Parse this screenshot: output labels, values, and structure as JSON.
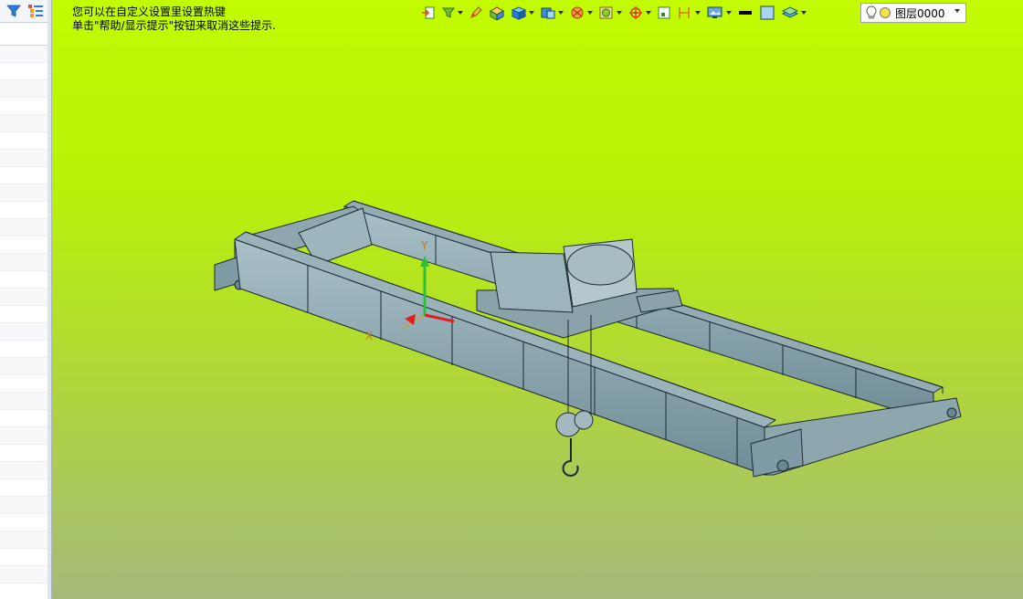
{
  "hint": {
    "line1": "您可以在自定义设置里设置热键",
    "line2": "单击\"帮助/显示提示\"按钮来取消这些提示."
  },
  "layer": {
    "value": "图层0000"
  },
  "axes": {
    "x_label": "X",
    "y_label": "Y"
  },
  "colors": {
    "viewport_top": "#c2fb02",
    "viewport_bottom": "#a5b97b",
    "model_fill": "#7f9ba5",
    "model_edge": "#1c2a30"
  }
}
